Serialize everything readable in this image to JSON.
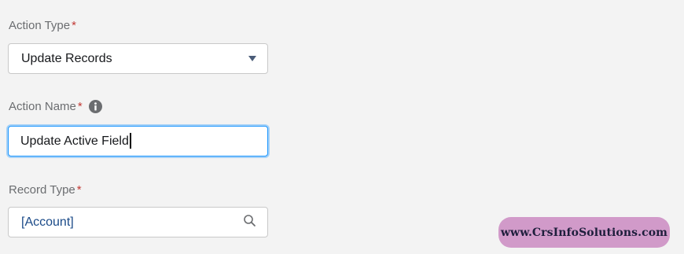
{
  "action_type": {
    "label": "Action Type",
    "required_marker": "*",
    "value": "Update Records"
  },
  "action_name": {
    "label": "Action Name",
    "required_marker": "*",
    "info_icon": "info-icon",
    "value": "Update Active Field"
  },
  "record_type": {
    "label": "Record Type",
    "required_marker": "*",
    "value": "[Account]",
    "icon": "search-icon"
  },
  "watermark": {
    "text": "www.CrsInfoSolutions.com"
  },
  "colors": {
    "background": "#f3f3f3",
    "required": "#c23934",
    "focus_border": "#1b96ff",
    "lookup_text": "#1a4a88",
    "watermark_bg": "#d19ac9"
  }
}
